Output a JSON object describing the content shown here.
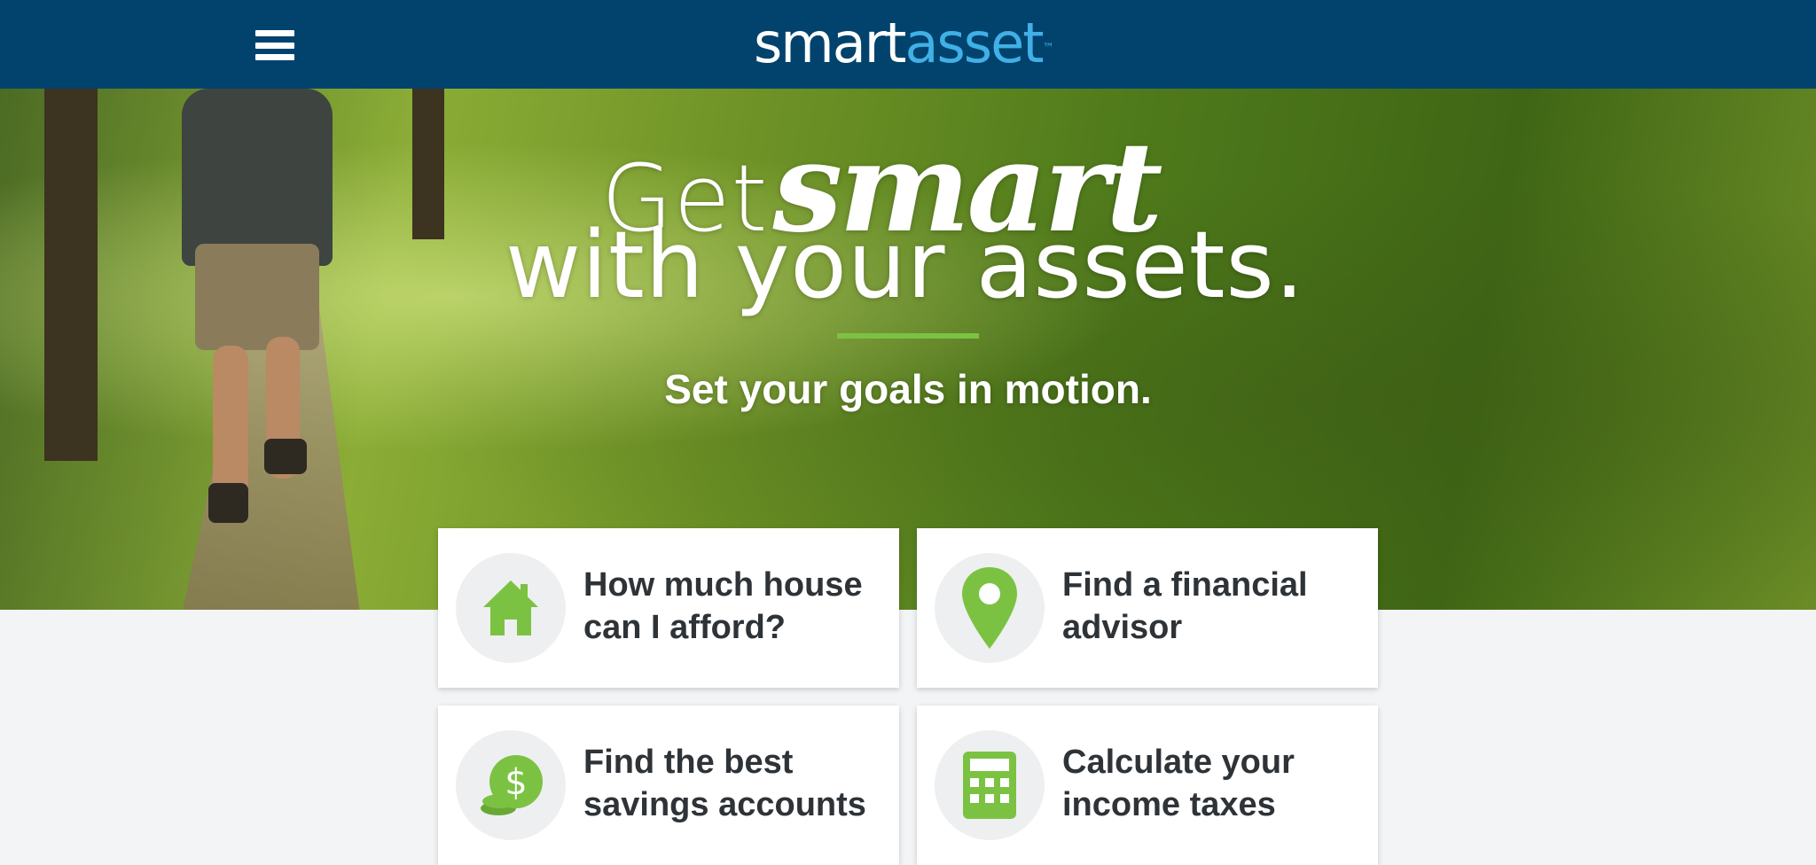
{
  "header": {
    "logo_part1": "smart",
    "logo_part2": "asset",
    "logo_tm": "™",
    "menu_icon": "hamburger-menu-icon"
  },
  "hero": {
    "headline_get": "Get",
    "headline_smart": "smart",
    "headline_line2": "with your assets.",
    "tagline": "Set your goals in motion.",
    "accent_color": "#7cc242"
  },
  "cards": [
    {
      "line1": "How much house",
      "line2": "can I afford?",
      "icon": "house-icon"
    },
    {
      "line1": "Find a financial",
      "line2": "advisor",
      "icon": "location-pin-icon"
    },
    {
      "line1": "Find the best",
      "line2": "savings accounts",
      "icon": "dollar-coins-icon"
    },
    {
      "line1": "Calculate your",
      "line2": "income taxes",
      "icon": "calculator-icon"
    }
  ],
  "colors": {
    "header_bg": "#02436e",
    "logo_accent": "#40b0e6",
    "icon_green": "#7cc242"
  }
}
